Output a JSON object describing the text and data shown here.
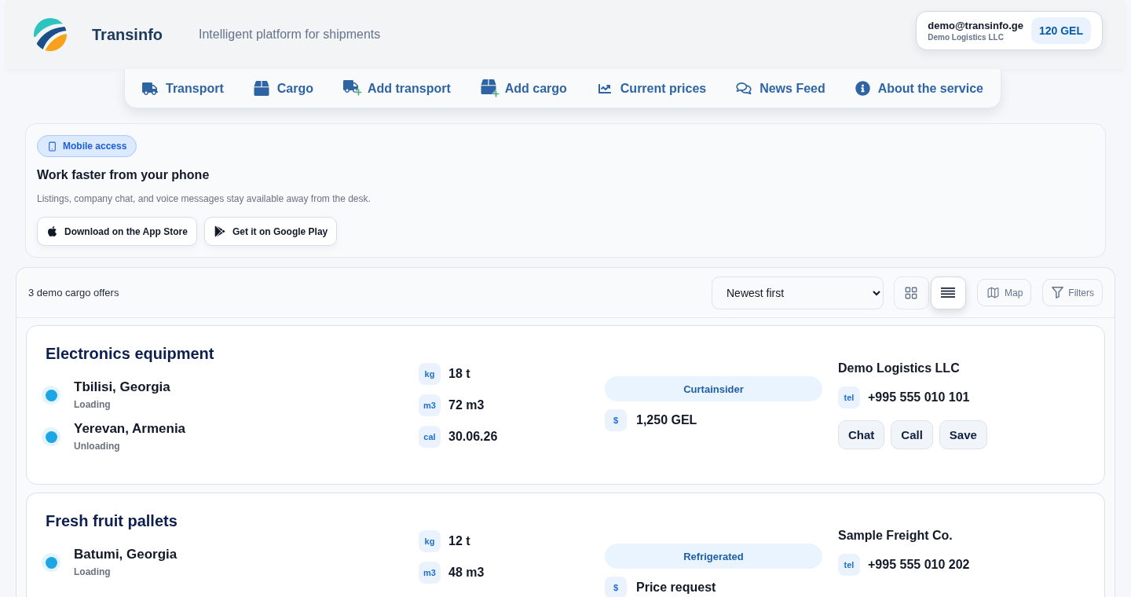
{
  "header": {
    "brand": "Transinfo",
    "tagline": "Intelligent platform for shipments",
    "account": {
      "email": "demo@transinfo.ge",
      "company": "Demo Logistics LLC",
      "balance": "120 GEL"
    }
  },
  "nav": [
    {
      "label": "Transport"
    },
    {
      "label": "Cargo"
    },
    {
      "label": "Add transport"
    },
    {
      "label": "Add cargo"
    },
    {
      "label": "Current prices"
    },
    {
      "label": "News Feed"
    },
    {
      "label": "About the service"
    }
  ],
  "promo": {
    "badge": "Mobile access",
    "title": "Work faster from your phone",
    "text": "Listings, company chat, and voice messages stay available away from the desk.",
    "buttons": [
      {
        "label": "Download on the App Store"
      },
      {
        "label": "Get it on Google Play"
      }
    ]
  },
  "listing": {
    "count": "3 demo cargo offers",
    "sort": {
      "value": "Newest first"
    },
    "views": [
      {
        "selected": false
      },
      {
        "selected": true
      }
    ],
    "actions": [
      {
        "label": "Map"
      },
      {
        "label": "Filters"
      }
    ],
    "offers": [
      {
        "title": "Electronics equipment",
        "stops": [
          {
            "city": "Tbilisi, Georgia",
            "role": "Loading"
          },
          {
            "city": "Yerevan, Armenia",
            "role": "Unloading"
          }
        ],
        "specs": [
          {
            "unit": "kg",
            "value": "18 t"
          },
          {
            "unit": "m3",
            "value": "72 m3"
          },
          {
            "unit": "cal",
            "value": "30.06.26"
          }
        ],
        "body_type": "Curtainsider",
        "price_tag": "$",
        "price": "1,250 GEL",
        "company": "Demo Logistics LLC",
        "phone_tag": "tel",
        "phone": "+995 555 010 101",
        "buttons": [
          "Chat",
          "Call",
          "Save"
        ]
      },
      {
        "title": "Fresh fruit pallets",
        "stops": [
          {
            "city": "Batumi, Georgia",
            "role": "Loading"
          }
        ],
        "specs": [
          {
            "unit": "kg",
            "value": "12 t"
          },
          {
            "unit": "m3",
            "value": "48 m3"
          }
        ],
        "body_type": "Refrigerated",
        "price_tag": "$",
        "price": "Price request",
        "company": "Sample Freight Co.",
        "phone_tag": "tel",
        "phone": "+995 555 010 202"
      }
    ]
  }
}
